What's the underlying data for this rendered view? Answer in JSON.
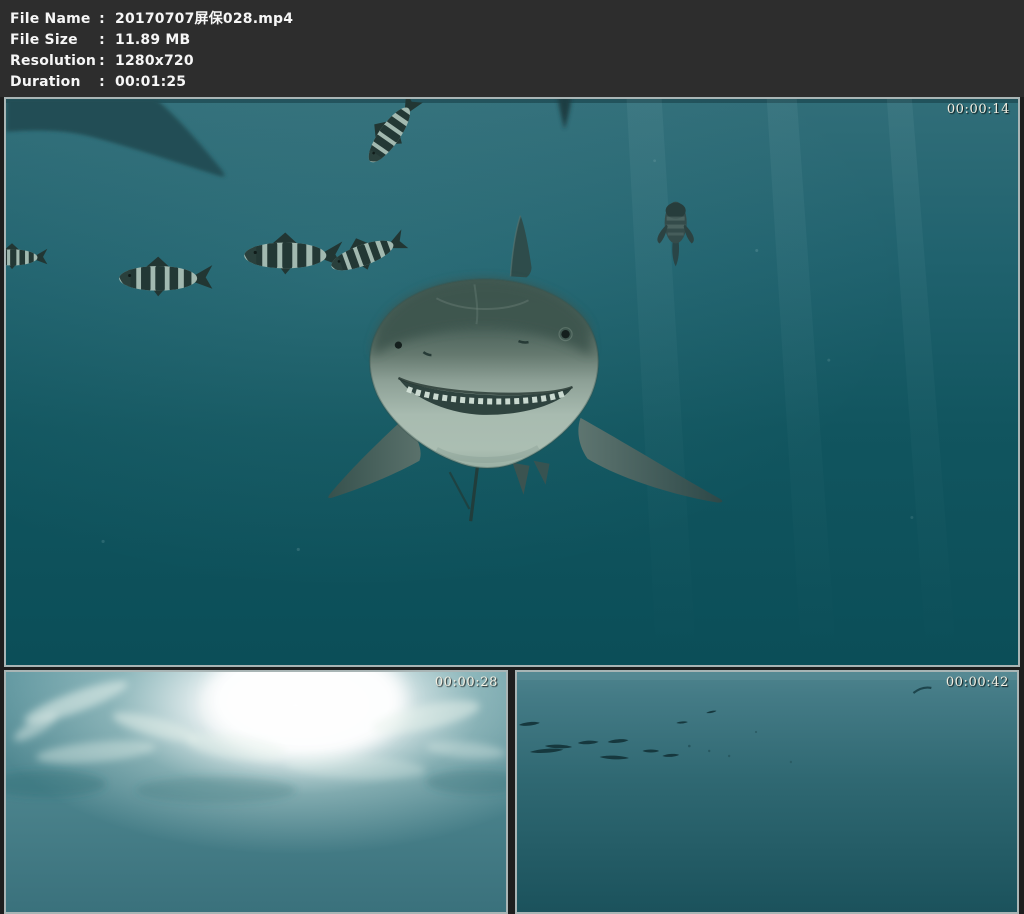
{
  "header": {
    "rows": [
      {
        "label": "File Name",
        "sep": ":",
        "value": "20170707屏保028.mp4"
      },
      {
        "label": "File Size",
        "sep": ":",
        "value": "11.89 MB"
      },
      {
        "label": "Resolution",
        "sep": ":",
        "value": "1280x720"
      },
      {
        "label": "Duration",
        "sep": ":",
        "value": "00:01:25"
      }
    ]
  },
  "preview": {
    "main_frame": {
      "timestamp": "00:00:14"
    },
    "thumbnails": [
      {
        "timestamp": "00:00:28"
      },
      {
        "timestamp": "00:00:42"
      }
    ]
  },
  "colors": {
    "page_background": "#1e1e1e",
    "header_background": "#2d2d2d",
    "header_text": "#f6f6f6",
    "frame_border": "#a9b5b5",
    "water_teal_light": "#316e79",
    "water_teal_dark": "#0b4e58",
    "timestamp_text": "#f1eee1"
  }
}
